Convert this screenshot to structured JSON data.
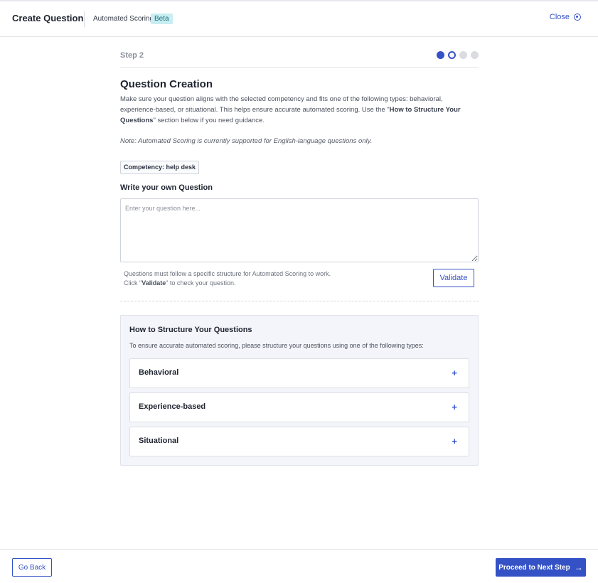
{
  "header": {
    "title": "Create Question",
    "subtitle": "Automated Scoring",
    "badge": "Beta",
    "close_label": "Close"
  },
  "steps": {
    "label": "Step 2",
    "total": 4,
    "current": 2
  },
  "content": {
    "heading": "Question Creation",
    "desc_part1": "Make sure your question aligns with the selected competency and fits one of the following types: behavioral, experience-based, or situational. This helps ensure accurate automated scoring. Use the \"",
    "desc_bold": "How to Structure Your Questions",
    "desc_part2": "\" section below if you need guidance.",
    "note": "Note: Automated Scoring is currently supported for English-language questions only.",
    "competency": "Competency: help desk",
    "write_label": "Write your own Question",
    "input_placeholder": "Enter your question here...",
    "input_value": "",
    "helper_line1": "Questions must follow a specific structure for Automated Scoring to work.",
    "helper_line2_pre": "Click \"",
    "helper_line2_bold": "Validate",
    "helper_line2_post": "\" to check your question.",
    "validate_label": "Validate"
  },
  "structure": {
    "title": "How to Structure Your Questions",
    "subtitle": "To ensure accurate automated scoring, please structure your questions using one of the following types:",
    "items": [
      {
        "label": "Behavioral",
        "icon": "plus-icon"
      },
      {
        "label": "Experience-based",
        "icon": "plus-icon"
      },
      {
        "label": "Situational",
        "icon": "plus-icon"
      }
    ]
  },
  "footer": {
    "back_label": "Go Back",
    "next_label": "Proceed to Next Step"
  },
  "colors": {
    "primary": "#3452c6",
    "badge_bg": "#c8eef2",
    "panel_bg": "#f4f5fa"
  }
}
